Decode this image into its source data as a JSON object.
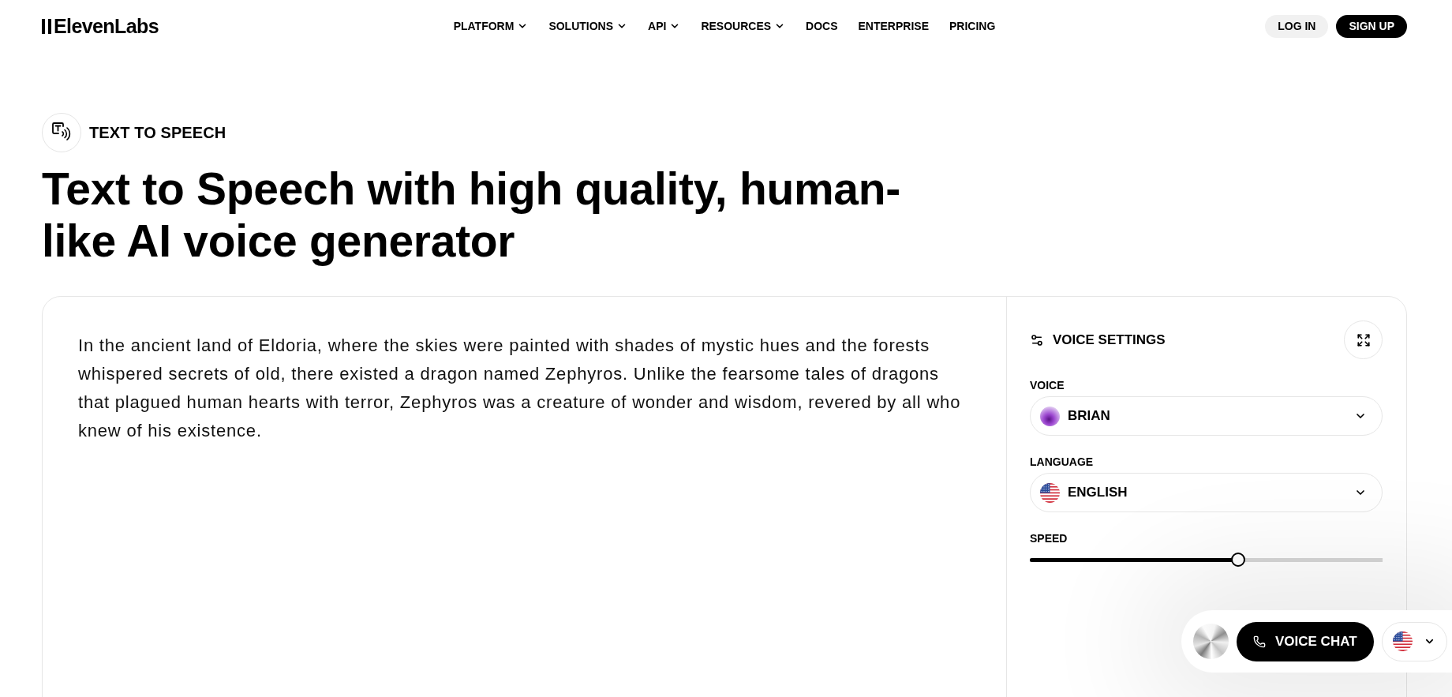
{
  "header": {
    "logo": "ElevenLabs",
    "nav": [
      {
        "label": "PLATFORM",
        "has_menu": true
      },
      {
        "label": "SOLUTIONS",
        "has_menu": true
      },
      {
        "label": "API",
        "has_menu": true
      },
      {
        "label": "RESOURCES",
        "has_menu": true
      },
      {
        "label": "DOCS",
        "has_menu": false
      },
      {
        "label": "ENTERPRISE",
        "has_menu": false
      },
      {
        "label": "PRICING",
        "has_menu": false
      }
    ],
    "actions": [
      {
        "label": "LOG IN",
        "kind": "secondary"
      },
      {
        "label": "SIGN UP",
        "kind": "primary"
      }
    ]
  },
  "hero": {
    "badge": "TEXT TO SPEECH",
    "title": "Text to Speech with high quality, human-like AI voice generator"
  },
  "editor": {
    "text": "In the ancient land of Eldoria, where the skies were painted with shades of mystic hues and the forests whispered secrets of old, there existed a dragon named Zephyros. Unlike the fearsome tales of dragons that plagued human hearts with terror, Zephyros was a creature of wonder and wisdom, revered by all who knew of his existence."
  },
  "voice_settings": {
    "title": "VOICE SETTINGS",
    "fields": [
      {
        "kind": "voice",
        "label": "VOICE",
        "value": "BRIAN"
      },
      {
        "kind": "language",
        "label": "LANGUAGE",
        "value": "ENGLISH"
      },
      {
        "kind": "slider",
        "label": "SPEED",
        "level": 0.59
      }
    ]
  },
  "voice_chat": {
    "button": "VOICE CHAT"
  }
}
